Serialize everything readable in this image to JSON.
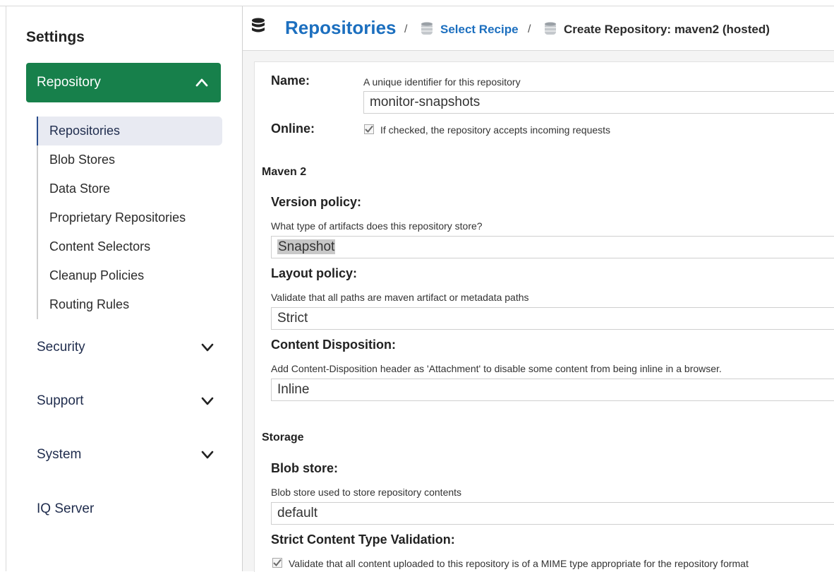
{
  "sidebar": {
    "title": "Settings",
    "repository_header": "Repository",
    "items": [
      "Repositories",
      "Blob Stores",
      "Data Store",
      "Proprietary Repositories",
      "Content Selectors",
      "Cleanup Policies",
      "Routing Rules"
    ],
    "sections": [
      "Security",
      "Support",
      "System",
      "IQ Server"
    ]
  },
  "breadcrumb": {
    "title": "Repositories",
    "separator": "/",
    "recipe_link": "Select Recipe",
    "current": "Create Repository: maven2 (hosted)"
  },
  "form": {
    "name_label": "Name:",
    "name_help": "A unique identifier for this repository",
    "name_value": "monitor-snapshots",
    "online_label": "Online:",
    "online_help": "If checked, the repository accepts incoming requests",
    "maven_section": "Maven 2",
    "version_label": "Version policy:",
    "version_help": "What type of artifacts does this repository store?",
    "version_value": "Snapshot",
    "layout_label": "Layout policy:",
    "layout_help": "Validate that all paths are maven artifact or metadata paths",
    "layout_value": "Strict",
    "disposition_label": "Content Disposition:",
    "disposition_help": "Add Content-Disposition header as 'Attachment' to disable some content from being inline in a browser.",
    "disposition_value": "Inline",
    "storage_section": "Storage",
    "blob_label": "Blob store:",
    "blob_help": "Blob store used to store repository contents",
    "blob_value": "default",
    "strict_label": "Strict Content Type Validation:",
    "strict_help": "Validate that all content uploaded to this repository is of a MIME type appropriate for the repository format"
  },
  "colors": {
    "accent_green": "#17804b",
    "link_blue": "#1c6fbf"
  }
}
